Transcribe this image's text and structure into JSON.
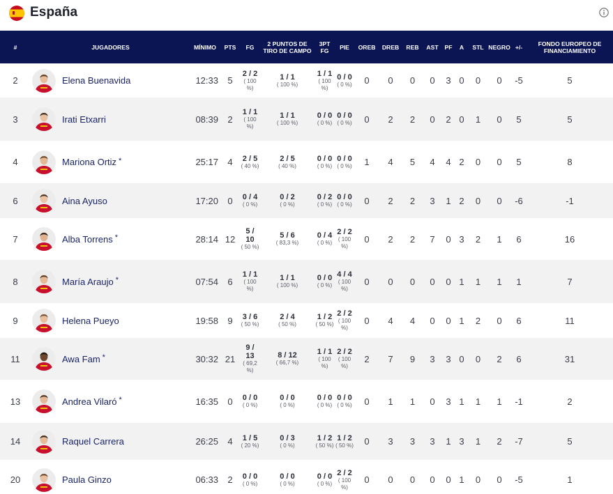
{
  "team": {
    "name": "España",
    "flag_icon": "spain-flag-icon"
  },
  "info_icon": "info-icon",
  "headers": {
    "num": "#",
    "players": "JUGADORES",
    "min": "MÍNIMO",
    "pts": "PTS",
    "fg": "FG",
    "two_pt": "2 PUNTOS DE TIRO DE CAMPO",
    "three_pt": "3PT FG",
    "ft": "PIE",
    "oreb": "OREB",
    "dreb": "DREB",
    "reb": "REB",
    "ast": "AST",
    "pf": "PF",
    "a": "A",
    "stl": "STL",
    "blk": "NEGRO",
    "pm": "+/-",
    "eff": "FONDO EUROPEO DE FINANCIAMIENTO"
  },
  "rows": [
    {
      "num": "2",
      "name": "Elena Buenavida",
      "star": "",
      "min": "12:33",
      "pts": "5",
      "fg_m": "2 / 2",
      "fg_p": "( 100 %)",
      "two_m": "1 / 1",
      "two_p": "( 100 %)",
      "three_m": "1 / 1",
      "three_p": "( 100 %)",
      "ft_m": "0 / 0",
      "ft_p": "( 0 %)",
      "oreb": "0",
      "dreb": "0",
      "reb": "0",
      "ast": "0",
      "pf": "3",
      "a": "0",
      "stl": "0",
      "blk": "0",
      "pm": "-5",
      "eff": "5"
    },
    {
      "num": "3",
      "name": "Irati Etxarri",
      "star": "",
      "min": "08:39",
      "pts": "2",
      "fg_m": "1 / 1",
      "fg_p": "( 100 %)",
      "two_m": "1 / 1",
      "two_p": "( 100 %)",
      "three_m": "0 / 0",
      "three_p": "( 0 %)",
      "ft_m": "0 / 0",
      "ft_p": "( 0 %)",
      "oreb": "0",
      "dreb": "2",
      "reb": "2",
      "ast": "0",
      "pf": "2",
      "a": "0",
      "stl": "1",
      "blk": "0",
      "pm": "5",
      "eff": "5"
    },
    {
      "num": "4",
      "name": "Mariona Ortiz",
      "star": "*",
      "min": "25:17",
      "pts": "4",
      "fg_m": "2 / 5",
      "fg_p": "( 40 %)",
      "two_m": "2 / 5",
      "two_p": "( 40 %)",
      "three_m": "0 / 0",
      "three_p": "( 0 %)",
      "ft_m": "0 / 0",
      "ft_p": "( 0 %)",
      "oreb": "1",
      "dreb": "4",
      "reb": "5",
      "ast": "4",
      "pf": "4",
      "a": "2",
      "stl": "0",
      "blk": "0",
      "pm": "5",
      "eff": "8"
    },
    {
      "num": "6",
      "name": "Aina Ayuso",
      "star": "",
      "min": "17:20",
      "pts": "0",
      "fg_m": "0 / 4",
      "fg_p": "( 0 %)",
      "two_m": "0 / 2",
      "two_p": "( 0 %)",
      "three_m": "0 / 2",
      "three_p": "( 0 %)",
      "ft_m": "0 / 0",
      "ft_p": "( 0 %)",
      "oreb": "0",
      "dreb": "2",
      "reb": "2",
      "ast": "3",
      "pf": "1",
      "a": "2",
      "stl": "0",
      "blk": "0",
      "pm": "-6",
      "eff": "-1"
    },
    {
      "num": "7",
      "name": "Alba Torrens",
      "star": "*",
      "min": "28:14",
      "pts": "12",
      "fg_m": "5 / 10",
      "fg_p": "( 50 %)",
      "two_m": "5 / 6",
      "two_p": "( 83,3 %)",
      "three_m": "0 / 4",
      "three_p": "( 0 %)",
      "ft_m": "2 / 2",
      "ft_p": "( 100 %)",
      "oreb": "0",
      "dreb": "2",
      "reb": "2",
      "ast": "7",
      "pf": "0",
      "a": "3",
      "stl": "2",
      "blk": "1",
      "pm": "6",
      "eff": "16"
    },
    {
      "num": "8",
      "name": "María Araujo",
      "star": "*",
      "min": "07:54",
      "pts": "6",
      "fg_m": "1 / 1",
      "fg_p": "( 100 %)",
      "two_m": "1 / 1",
      "two_p": "( 100 %)",
      "three_m": "0 / 0",
      "three_p": "( 0 %)",
      "ft_m": "4 / 4",
      "ft_p": "( 100 %)",
      "oreb": "0",
      "dreb": "0",
      "reb": "0",
      "ast": "0",
      "pf": "0",
      "a": "1",
      "stl": "1",
      "blk": "1",
      "pm": "1",
      "eff": "7"
    },
    {
      "num": "9",
      "name": "Helena Pueyo",
      "star": "",
      "min": "19:58",
      "pts": "9",
      "fg_m": "3 / 6",
      "fg_p": "( 50 %)",
      "two_m": "2 / 4",
      "two_p": "( 50 %)",
      "three_m": "1 / 2",
      "three_p": "( 50 %)",
      "ft_m": "2 / 2",
      "ft_p": "( 100 %)",
      "oreb": "0",
      "dreb": "4",
      "reb": "4",
      "ast": "0",
      "pf": "0",
      "a": "1",
      "stl": "2",
      "blk": "0",
      "pm": "6",
      "eff": "11"
    },
    {
      "num": "11",
      "name": "Awa Fam",
      "star": "*",
      "min": "30:32",
      "pts": "21",
      "fg_m": "9 / 13",
      "fg_p": "( 69,2 %)",
      "two_m": "8 / 12",
      "two_p": "( 66,7 %)",
      "three_m": "1 / 1",
      "three_p": "( 100 %)",
      "ft_m": "2 / 2",
      "ft_p": "( 100 %)",
      "oreb": "2",
      "dreb": "7",
      "reb": "9",
      "ast": "3",
      "pf": "3",
      "a": "0",
      "stl": "0",
      "blk": "2",
      "pm": "6",
      "eff": "31"
    },
    {
      "num": "13",
      "name": "Andrea Vilaró",
      "star": "*",
      "min": "16:35",
      "pts": "0",
      "fg_m": "0 / 0",
      "fg_p": "( 0 %)",
      "two_m": "0 / 0",
      "two_p": "( 0 %)",
      "three_m": "0 / 0",
      "three_p": "( 0 %)",
      "ft_m": "0 / 0",
      "ft_p": "( 0 %)",
      "oreb": "0",
      "dreb": "1",
      "reb": "1",
      "ast": "0",
      "pf": "3",
      "a": "1",
      "stl": "1",
      "blk": "1",
      "pm": "-1",
      "eff": "2"
    },
    {
      "num": "14",
      "name": "Raquel Carrera",
      "star": "",
      "min": "26:25",
      "pts": "4",
      "fg_m": "1 / 5",
      "fg_p": "( 20 %)",
      "two_m": "0 / 3",
      "two_p": "( 0 %)",
      "three_m": "1 / 2",
      "three_p": "( 50 %)",
      "ft_m": "1 / 2",
      "ft_p": "( 50 %)",
      "oreb": "0",
      "dreb": "3",
      "reb": "3",
      "ast": "3",
      "pf": "1",
      "a": "3",
      "stl": "1",
      "blk": "2",
      "pm": "-7",
      "eff": "5"
    },
    {
      "num": "20",
      "name": "Paula Ginzo",
      "star": "",
      "min": "06:33",
      "pts": "2",
      "fg_m": "0 / 0",
      "fg_p": "( 0 %)",
      "two_m": "0 / 0",
      "two_p": "( 0 %)",
      "three_m": "0 / 0",
      "three_p": "( 0 %)",
      "ft_m": "2 / 2",
      "ft_p": "( 100 %)",
      "oreb": "0",
      "dreb": "0",
      "reb": "0",
      "ast": "0",
      "pf": "0",
      "a": "1",
      "stl": "0",
      "blk": "0",
      "pm": "-5",
      "eff": "1"
    }
  ],
  "colors": {
    "header_bg": "#0b1554",
    "player_link": "#1a2466",
    "row_alt": "#f2f2f3",
    "jersey_red": "#c8102e"
  }
}
